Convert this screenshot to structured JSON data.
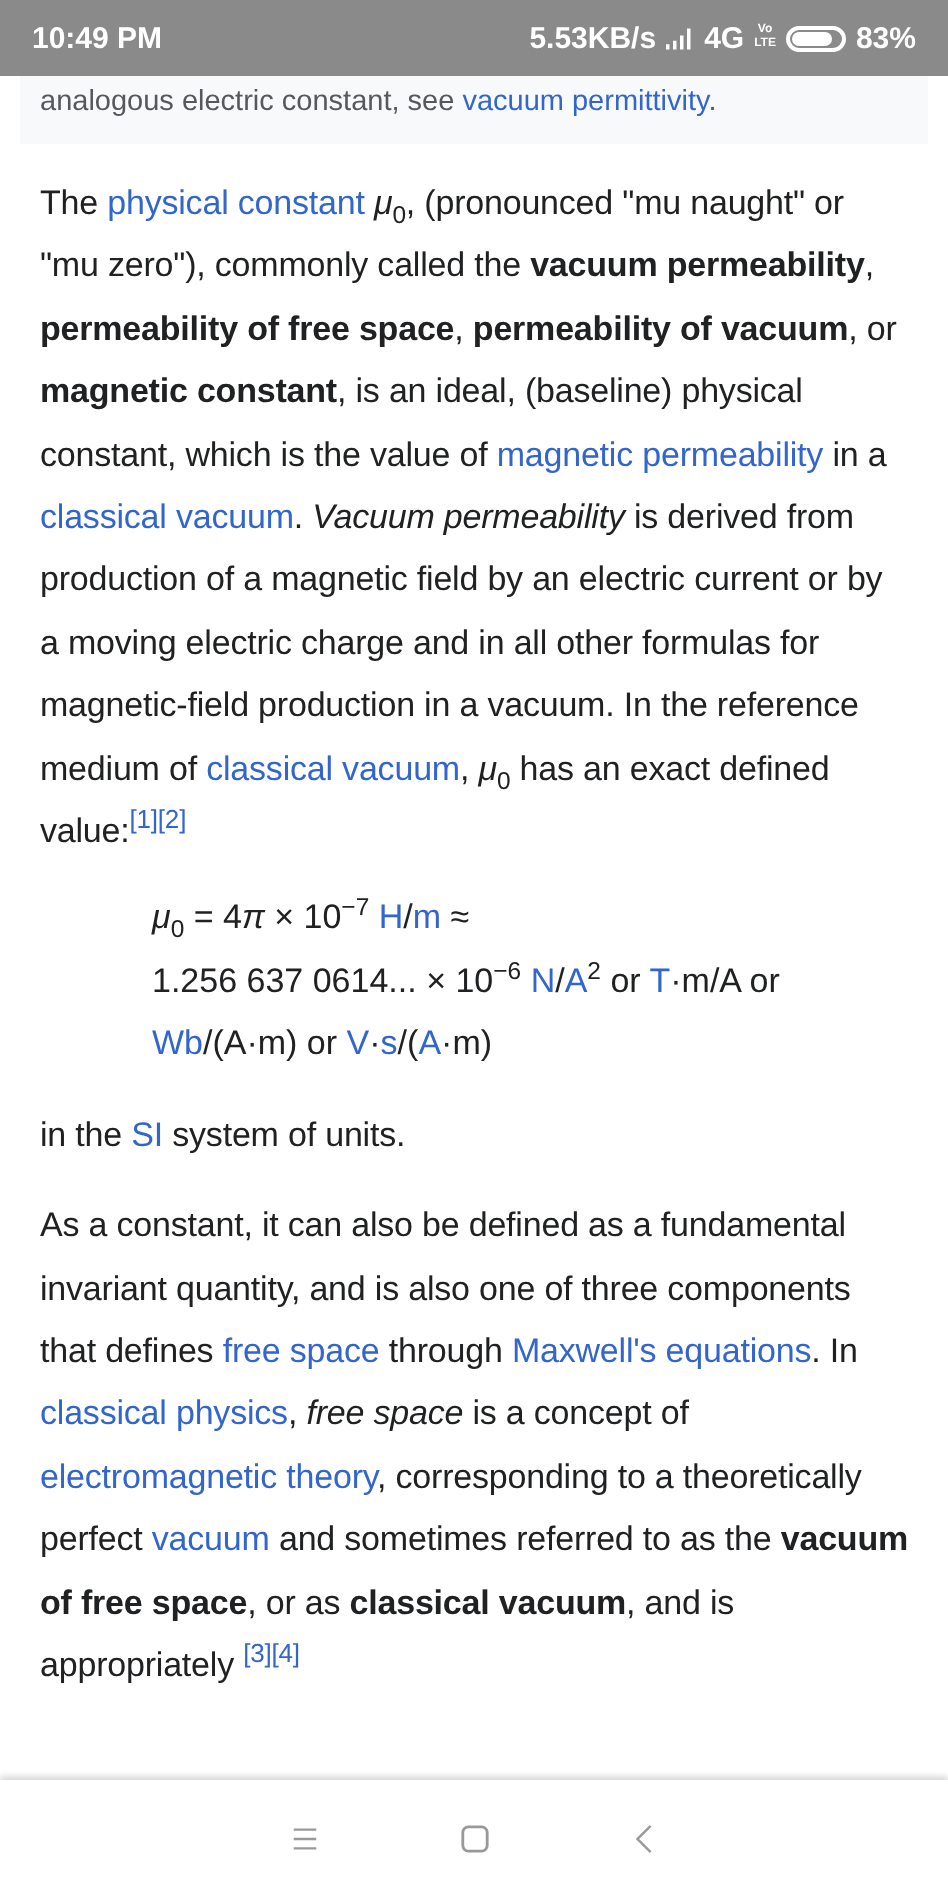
{
  "status_bar": {
    "time": "10:49 PM",
    "speed": "5.53KB/s",
    "network": "4G",
    "volte_top": "Vo",
    "volte_bottom": "LTE",
    "battery": {
      "level": 0.83
    },
    "battery_text": "83%"
  },
  "note": [
    {
      "kind": "text",
      "t": "analogous electric constant, see "
    },
    {
      "kind": "link",
      "t": "vacuum permittivity"
    },
    {
      "kind": "text",
      "t": "."
    }
  ],
  "paragraphs": [
    [
      {
        "kind": "text",
        "t": "The "
      },
      {
        "kind": "link",
        "t": "physical constant"
      },
      {
        "kind": "text",
        "t": " *μ*$_{0}$, (pronounced \"mu naught\" or \"mu zero\"), commonly called the **vacuum permeability**, **permeability of free space**, **permeability of vacuum**, or **magnetic constant**, is an ideal, (baseline) physical constant, which is the value of "
      },
      {
        "kind": "link",
        "t": "magnetic permeability"
      },
      {
        "kind": "text",
        "t": " in a "
      },
      {
        "kind": "link",
        "t": "classical vacuum"
      },
      {
        "kind": "text",
        "t": ". "
      },
      {
        "kind": "italic",
        "t": "Vacuum permeability"
      },
      {
        "kind": "text",
        "t": " is derived from production of a magnetic field by an electric current or by a moving electric charge and in all other formulas for magnetic-field production in a vacuum. In the reference medium of "
      },
      {
        "kind": "link",
        "t": "classical vacuum"
      },
      {
        "kind": "text",
        "t": ", *μ*$_{0}$ has an exact defined value:"
      },
      {
        "kind": "cite",
        "t": "[1]"
      },
      {
        "kind": "cite",
        "t": "[2]"
      }
    ]
  ],
  "formula": [
    [
      {
        "kind": "text",
        "t": "*μ*$_{0}$ = 4"
      },
      {
        "kind": "italic",
        "t": "π"
      },
      {
        "kind": "text",
        "t": " × 10$^{−7}$ "
      },
      {
        "kind": "link",
        "t": "H"
      },
      {
        "kind": "text",
        "t": "/"
      },
      {
        "kind": "link",
        "t": "m"
      },
      {
        "kind": "text",
        "t": " ≈"
      }
    ],
    [
      {
        "kind": "text",
        "t": "1.256 637 0614... × 10$^{−6}$ "
      },
      {
        "kind": "link",
        "t": "N"
      },
      {
        "kind": "text",
        "t": "/"
      },
      {
        "kind": "link",
        "t": "A"
      },
      {
        "kind": "text",
        "t": "$^{2}$ or "
      },
      {
        "kind": "link",
        "t": "T"
      },
      {
        "kind": "text",
        "t": "·m/A or"
      }
    ],
    [
      {
        "kind": "link",
        "t": "Wb"
      },
      {
        "kind": "text",
        "t": "/(A·m) or "
      },
      {
        "kind": "link",
        "t": "V"
      },
      {
        "kind": "text",
        "t": "·"
      },
      {
        "kind": "link",
        "t": "s"
      },
      {
        "kind": "text",
        "t": "/("
      },
      {
        "kind": "link",
        "t": "A"
      },
      {
        "kind": "text",
        "t": "·m)"
      }
    ]
  ],
  "after_formula": [
    {
      "kind": "text",
      "t": "in the "
    },
    {
      "kind": "link",
      "t": "SI"
    },
    {
      "kind": "text",
      "t": " system of units."
    }
  ],
  "paragraphs_2": [
    [
      {
        "kind": "text",
        "t": "As a constant, it can also be defined as a fundamental invariant quantity, and is also one of three components that defines "
      },
      {
        "kind": "link",
        "t": "free space"
      },
      {
        "kind": "text",
        "t": " through "
      },
      {
        "kind": "link",
        "t": "Maxwell's equations"
      },
      {
        "kind": "text",
        "t": ". In "
      },
      {
        "kind": "link",
        "t": "classical physics"
      },
      {
        "kind": "text",
        "t": ", "
      },
      {
        "kind": "italic",
        "t": "free space"
      },
      {
        "kind": "text",
        "t": " is a concept of "
      },
      {
        "kind": "link",
        "t": "electromagnetic theory"
      },
      {
        "kind": "text",
        "t": ", corresponding to a theoretically perfect "
      },
      {
        "kind": "link",
        "t": "vacuum"
      },
      {
        "kind": "text",
        "t": " and sometimes referred to as the **vacuum of free space**, or as **classical vacuum**, and is appropriately "
      },
      {
        "kind": "cite",
        "t": "[3]"
      },
      {
        "kind": "cite",
        "t": "[4]"
      }
    ]
  ]
}
